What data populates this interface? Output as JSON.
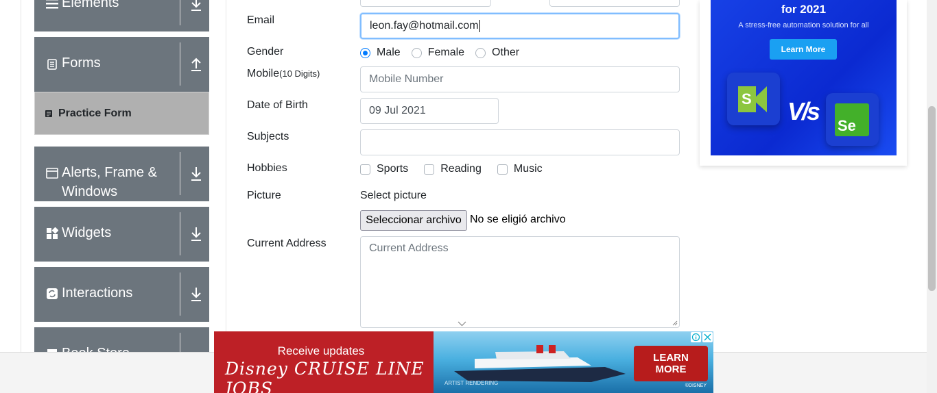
{
  "sidebar": {
    "groups": [
      {
        "label": "Elements",
        "icon": "list-icon"
      },
      {
        "label": "Forms",
        "icon": "document-icon"
      },
      {
        "label": "Alerts, Frame & Windows",
        "icon": "window-icon"
      },
      {
        "label": "Widgets",
        "icon": "widgets-icon"
      },
      {
        "label": "Interactions",
        "icon": "refresh-icon"
      },
      {
        "label": "Book Store",
        "icon": "book-icon"
      }
    ],
    "active_item": "Practice Form"
  },
  "form": {
    "email_label": "Email",
    "email_value": "leon.fay@hotmail.com",
    "gender_label": "Gender",
    "gender_options": [
      "Male",
      "Female",
      "Other"
    ],
    "gender_selected": "Male",
    "mobile_label": "Mobile",
    "mobile_hint": "(10 Digits)",
    "mobile_placeholder": "Mobile Number",
    "dob_label": "Date of Birth",
    "dob_value": "09 Jul 2021",
    "subjects_label": "Subjects",
    "subjects_value": "",
    "hobbies_label": "Hobbies",
    "hobbies_options": [
      "Sports",
      "Reading",
      "Music"
    ],
    "picture_label": "Picture",
    "picture_select": "Select picture",
    "file_button": "Seleccionar archivo",
    "file_status": "No se eligió archivo",
    "address_label": "Current Address",
    "address_placeholder": "Current Address"
  },
  "side_ad": {
    "headline": "for 2021",
    "tagline": "A stress-free automation solution for all",
    "cta": "Learn More",
    "vs": "V/s",
    "logo_left": "S",
    "logo_right": "Se"
  },
  "bottom_ad": {
    "line1": "Receive updates",
    "line2": "Disney CRUISE LINE JOBS",
    "note": "ARTIST RENDERING",
    "copyright": "©DISNEY",
    "cta_line1": "LEARN",
    "cta_line2": "MORE"
  }
}
